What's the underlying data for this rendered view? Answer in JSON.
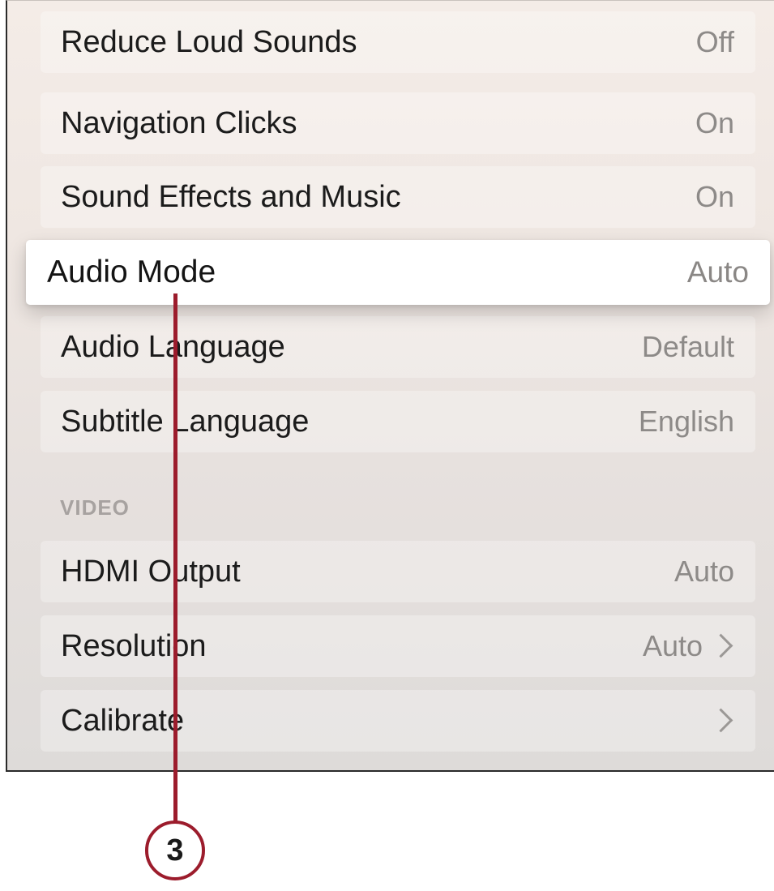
{
  "settings": {
    "rows": [
      {
        "label": "Reduce Loud Sounds",
        "value": "Off"
      },
      {
        "label": "Navigation Clicks",
        "value": "On"
      },
      {
        "label": "Sound Effects and Music",
        "value": "On"
      },
      {
        "label": "Audio Mode",
        "value": "Auto",
        "focused": true
      },
      {
        "label": "Audio Language",
        "value": "Default"
      },
      {
        "label": "Subtitle Language",
        "value": "English"
      }
    ],
    "video_section": {
      "header": "VIDEO",
      "rows": [
        {
          "label": "HDMI Output",
          "value": "Auto"
        },
        {
          "label": "Resolution",
          "value": "Auto",
          "has_chevron": true
        },
        {
          "label": "Calibrate",
          "value": "",
          "has_chevron": true
        }
      ]
    }
  },
  "callout": {
    "number": "3",
    "color": "#9c1c2c"
  },
  "icons": {
    "chevron": "chevron-right-icon"
  }
}
